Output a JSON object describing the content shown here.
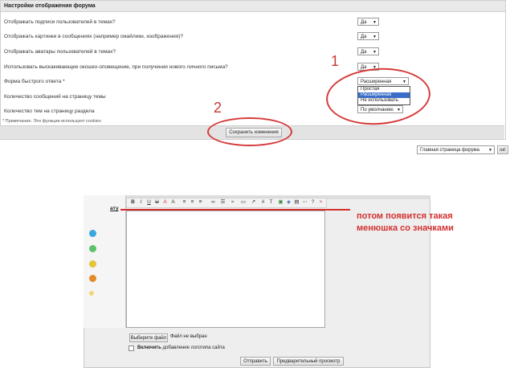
{
  "settings": {
    "header": "Настройки отображения форума",
    "rows": [
      {
        "label": "Отображать подписи пользователей в темах?",
        "value": "Да"
      },
      {
        "label": "Отображать картинки в сообщениях (например смайлики, изображения)?",
        "value": "Да"
      },
      {
        "label": "Отображать аватары пользователей в темах?",
        "value": "Да"
      },
      {
        "label": "Использовать выскакивающее окошко-оповещение, при получении нового личного письма?",
        "value": "Да"
      },
      {
        "label": "Форма быстрого ответа *",
        "value": "Расширенная"
      },
      {
        "label": "Количество сообщений на страницу темы",
        "value": ""
      },
      {
        "label": "Количество тем на страницу раздела",
        "value": "По умолчанию"
      }
    ],
    "dropdown_options": [
      "Простая",
      "Расширенная",
      "Не использовать"
    ],
    "dropdown_selected_index": 1,
    "footnote": "* Примечание. Эти функции используют cookies",
    "save_button": "Сохранить изменения"
  },
  "forum_jump": {
    "select_value": "Главная страница форума",
    "go_button": "ок!"
  },
  "annotations": {
    "num1": "1",
    "num2": "2",
    "note_line1": "потом появится такая",
    "note_line2": "менюшка со значками",
    "accent_color": "#d42f2f"
  },
  "editor": {
    "side_label": "ату",
    "toolbar": [
      "B",
      "I",
      "U",
      "U",
      "A",
      "A",
      "≡",
      "≡",
      "≡",
      "∞",
      "☰",
      "≈",
      "▭",
      "↗",
      "#",
      "T",
      "▣",
      "◈",
      "▤",
      "⋯",
      "?",
      "×"
    ],
    "file_button": "Выберите файл",
    "file_status": "Файл не выбран",
    "logo_checkbox_bold": "Включить",
    "logo_checkbox_rest": "добавление логотипа сайта",
    "send_button": "Отправить",
    "preview_button": "Предварительный просмотр"
  }
}
